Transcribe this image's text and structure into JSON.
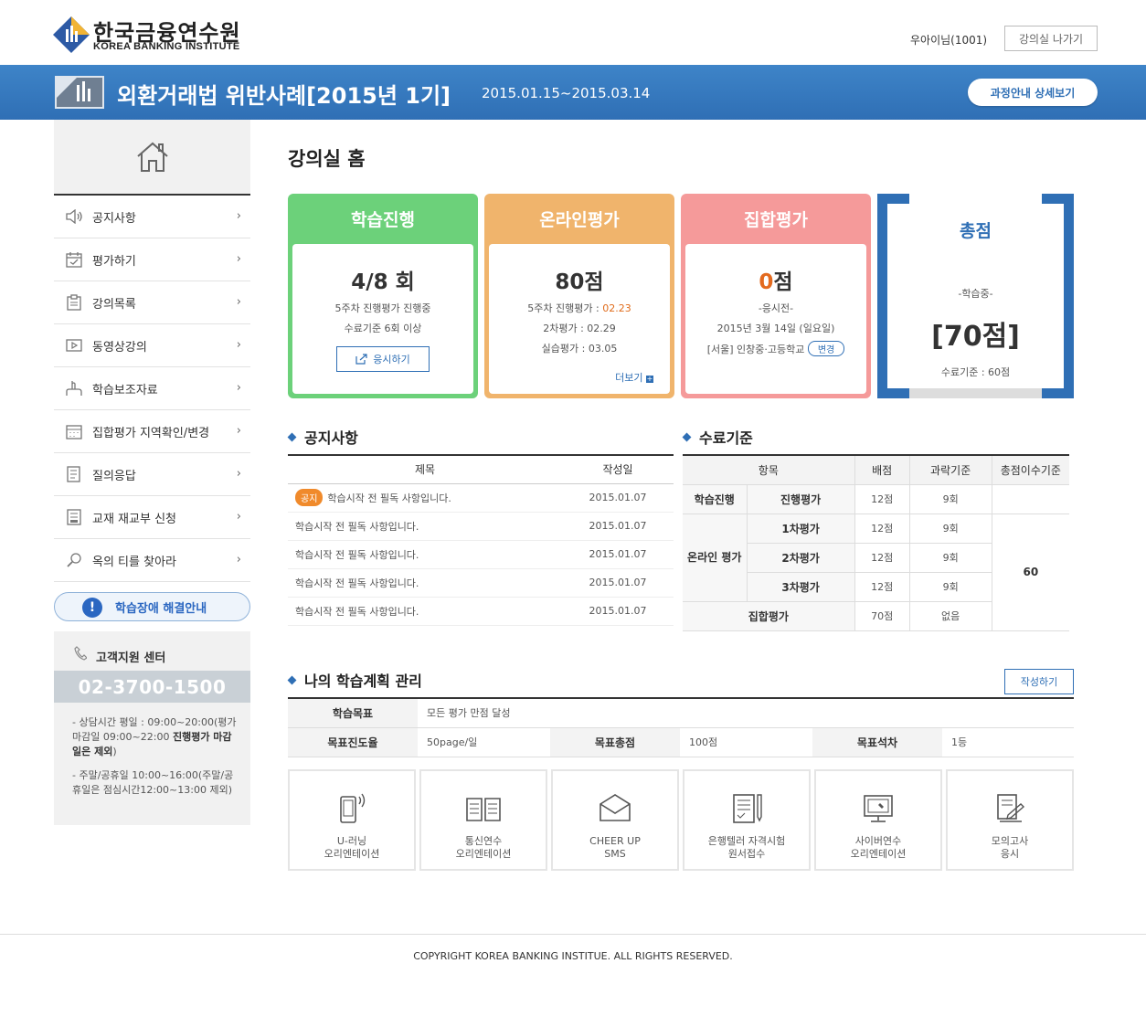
{
  "header": {
    "logo_kr": "한국금융연수원",
    "logo_en": "KOREA BANKING INSTITUTE",
    "user": "우아이님(1001)",
    "exit_label": "강의실 나가기"
  },
  "course": {
    "title": "외환거래법 위반사례[2015년 1기]",
    "period": "2015.01.15~2015.03.14",
    "detail_label": "과정안내 상세보기"
  },
  "sidebar": {
    "items": [
      {
        "label": "공지사항",
        "icon": "speaker-icon"
      },
      {
        "label": "평가하기",
        "icon": "calendar-check-icon"
      },
      {
        "label": "강의목록",
        "icon": "clipboard-icon"
      },
      {
        "label": "동영상강의",
        "icon": "video-icon"
      },
      {
        "label": "학습보조자료",
        "icon": "hand-icon"
      },
      {
        "label": "집합평가 지역확인/변경",
        "icon": "calendar-grid-icon"
      },
      {
        "label": "질의응답",
        "icon": "document-list-icon"
      },
      {
        "label": "교재 재교부 신청",
        "icon": "book-icon"
      },
      {
        "label": "옥의 티를 찾아라",
        "icon": "magnifier-icon"
      }
    ],
    "help_label": "학습장애 해결안내",
    "cs": {
      "title": "고객지원 센터",
      "phone": "02-3700-1500",
      "note1_a": "- 상담시간 평일 : 09:00~20:00(평가마감일 09:00~22:00 ",
      "note1_b": "진행평가 마감일은 제외",
      "note1_c": ")",
      "note2": "- 주말/공휴일 10:00~16:00(주말/공휴일은 점심시간12:00~13:00 제외)"
    }
  },
  "main": {
    "page_title": "강의실 홈",
    "cards": {
      "progress": {
        "title": "학습진행",
        "big": "4/8 회",
        "line1": "5주차 진행평가 진행중",
        "line2": "수료기준 6회 이상",
        "btn": "응시하기",
        "color": "#6cd17a"
      },
      "online": {
        "title": "온라인평가",
        "big": "80점",
        "line1_a": "5주차 진행평가 : ",
        "line1_b": "02.23",
        "line2": "2차평가 : 02.29",
        "line3": "실습평가 : 03.05",
        "more": "더보기",
        "color": "#f0b46c"
      },
      "group": {
        "title": "집합평가",
        "big_a": "0",
        "big_b": "점",
        "line1": "-응시전-",
        "line2": "2015년 3월 14일 (일요일)",
        "line3": "[서울] 인창중·고등학교",
        "change": "변경",
        "color": "#f59a9a"
      },
      "total": {
        "title": "총점",
        "status": "-학습중-",
        "score": "[70점]",
        "criteria": "수료기준 : 60점",
        "color": "#2f6fb5"
      }
    },
    "notice": {
      "title": "공지사항",
      "headers": [
        "제목",
        "작성일"
      ],
      "badge": "공지",
      "rows": [
        {
          "title": "학습시작 전 필독 사항입니다.",
          "date": "2015.01.07"
        },
        {
          "title": "학습시작 전 필독 사항입니다.",
          "date": "2015.01.07"
        },
        {
          "title": "학습시작 전 필독 사항입니다.",
          "date": "2015.01.07"
        },
        {
          "title": "학습시작 전 필독 사항입니다.",
          "date": "2015.01.07"
        },
        {
          "title": "학습시작 전 필독 사항입니다.",
          "date": "2015.01.07"
        }
      ]
    },
    "criteria": {
      "title": "수료기준",
      "headers": [
        "항목",
        "배점",
        "과락기준",
        "총점이수기준"
      ],
      "progress_label": "학습진행",
      "progress_sub": "진행평가",
      "online_label": "온라인 평가",
      "sub1": "1차평가",
      "sub2": "2차평가",
      "sub3": "3차평가",
      "group_label": "집합평가",
      "score12": "12점",
      "fail9": "9회",
      "score70": "70점",
      "none": "없음",
      "total": "60"
    },
    "plan": {
      "title": "나의 학습계획 관리",
      "write": "작성하기",
      "goal_label": "학습목표",
      "goal": "모든 평가 만점 달성",
      "rate_label": "목표진도율",
      "rate": "50page/일",
      "score_label": "목표총점",
      "score": "100점",
      "rank_label": "목표석차",
      "rank": "1등"
    },
    "quick": [
      {
        "line1": "U-러닝",
        "line2": "오리엔테이션",
        "icon": "mobile-icon"
      },
      {
        "line1": "통신연수",
        "line2": "오리엔테이션",
        "icon": "open-book-icon"
      },
      {
        "line1": "CHEER UP",
        "line2": "SMS",
        "icon": "envelope-icon"
      },
      {
        "line1": "은행텔러 자격시험",
        "line2": "원서접수",
        "icon": "form-pen-icon"
      },
      {
        "line1": "사이버연수",
        "line2": "오리엔테이션",
        "icon": "monitor-icon"
      },
      {
        "line1": "모의고사",
        "line2": "응시",
        "icon": "exam-icon"
      }
    ]
  },
  "footer": {
    "copyright": "COPYRIGHT KOREA BANKING INSTITUE. ALL RIGHTS RESERVED."
  }
}
